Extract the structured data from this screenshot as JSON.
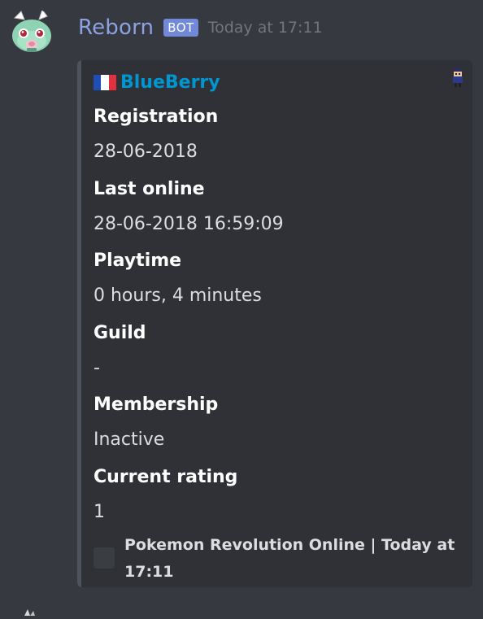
{
  "message": {
    "author": "Reborn",
    "bot_tag": "BOT",
    "timestamp": "Today at 17:11"
  },
  "embed": {
    "author_name": "BlueBerry",
    "fields": [
      {
        "name": "Registration",
        "value": "28-06-2018"
      },
      {
        "name": "Last online",
        "value": "28-06-2018 16:59:09"
      },
      {
        "name": "Playtime",
        "value": "0 hours, 4 minutes"
      },
      {
        "name": "Guild",
        "value": "-"
      },
      {
        "name": "Membership",
        "value": "Inactive"
      },
      {
        "name": "Current rating",
        "value": "1"
      }
    ],
    "footer": "Pokemon Revolution Online | Today at 17:11"
  },
  "colors": {
    "background": "#36393f",
    "embed_background": "#2f3136",
    "embed_bar": "#4f545c",
    "username": "#8ea1e1",
    "bot_tag": "#7289da",
    "author_link": "#0096cf",
    "timestamp": "#72767d"
  },
  "icons": [
    "bot-avatar-icon",
    "france-flag-icon",
    "character-thumbnail-icon",
    "footer-icon"
  ]
}
